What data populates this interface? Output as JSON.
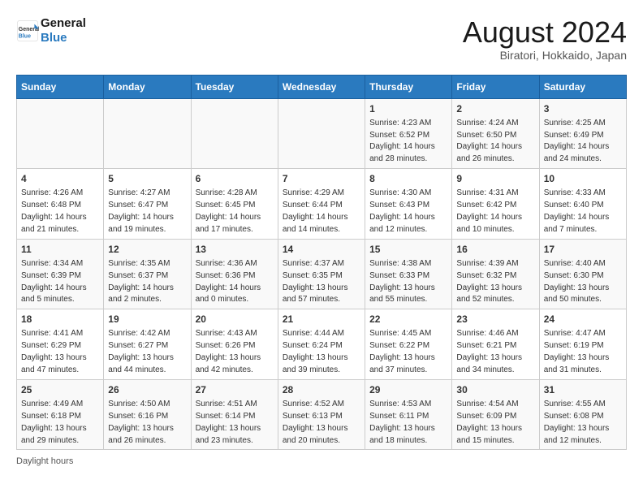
{
  "logo": {
    "line1": "General",
    "line2": "Blue"
  },
  "title": "August 2024",
  "location": "Biratori, Hokkaido, Japan",
  "weekdays": [
    "Sunday",
    "Monday",
    "Tuesday",
    "Wednesday",
    "Thursday",
    "Friday",
    "Saturday"
  ],
  "footer": "Daylight hours",
  "weeks": [
    [
      {
        "day": "",
        "info": ""
      },
      {
        "day": "",
        "info": ""
      },
      {
        "day": "",
        "info": ""
      },
      {
        "day": "",
        "info": ""
      },
      {
        "day": "1",
        "info": "Sunrise: 4:23 AM\nSunset: 6:52 PM\nDaylight: 14 hours and 28 minutes."
      },
      {
        "day": "2",
        "info": "Sunrise: 4:24 AM\nSunset: 6:50 PM\nDaylight: 14 hours and 26 minutes."
      },
      {
        "day": "3",
        "info": "Sunrise: 4:25 AM\nSunset: 6:49 PM\nDaylight: 14 hours and 24 minutes."
      }
    ],
    [
      {
        "day": "4",
        "info": "Sunrise: 4:26 AM\nSunset: 6:48 PM\nDaylight: 14 hours and 21 minutes."
      },
      {
        "day": "5",
        "info": "Sunrise: 4:27 AM\nSunset: 6:47 PM\nDaylight: 14 hours and 19 minutes."
      },
      {
        "day": "6",
        "info": "Sunrise: 4:28 AM\nSunset: 6:45 PM\nDaylight: 14 hours and 17 minutes."
      },
      {
        "day": "7",
        "info": "Sunrise: 4:29 AM\nSunset: 6:44 PM\nDaylight: 14 hours and 14 minutes."
      },
      {
        "day": "8",
        "info": "Sunrise: 4:30 AM\nSunset: 6:43 PM\nDaylight: 14 hours and 12 minutes."
      },
      {
        "day": "9",
        "info": "Sunrise: 4:31 AM\nSunset: 6:42 PM\nDaylight: 14 hours and 10 minutes."
      },
      {
        "day": "10",
        "info": "Sunrise: 4:33 AM\nSunset: 6:40 PM\nDaylight: 14 hours and 7 minutes."
      }
    ],
    [
      {
        "day": "11",
        "info": "Sunrise: 4:34 AM\nSunset: 6:39 PM\nDaylight: 14 hours and 5 minutes."
      },
      {
        "day": "12",
        "info": "Sunrise: 4:35 AM\nSunset: 6:37 PM\nDaylight: 14 hours and 2 minutes."
      },
      {
        "day": "13",
        "info": "Sunrise: 4:36 AM\nSunset: 6:36 PM\nDaylight: 14 hours and 0 minutes."
      },
      {
        "day": "14",
        "info": "Sunrise: 4:37 AM\nSunset: 6:35 PM\nDaylight: 13 hours and 57 minutes."
      },
      {
        "day": "15",
        "info": "Sunrise: 4:38 AM\nSunset: 6:33 PM\nDaylight: 13 hours and 55 minutes."
      },
      {
        "day": "16",
        "info": "Sunrise: 4:39 AM\nSunset: 6:32 PM\nDaylight: 13 hours and 52 minutes."
      },
      {
        "day": "17",
        "info": "Sunrise: 4:40 AM\nSunset: 6:30 PM\nDaylight: 13 hours and 50 minutes."
      }
    ],
    [
      {
        "day": "18",
        "info": "Sunrise: 4:41 AM\nSunset: 6:29 PM\nDaylight: 13 hours and 47 minutes."
      },
      {
        "day": "19",
        "info": "Sunrise: 4:42 AM\nSunset: 6:27 PM\nDaylight: 13 hours and 44 minutes."
      },
      {
        "day": "20",
        "info": "Sunrise: 4:43 AM\nSunset: 6:26 PM\nDaylight: 13 hours and 42 minutes."
      },
      {
        "day": "21",
        "info": "Sunrise: 4:44 AM\nSunset: 6:24 PM\nDaylight: 13 hours and 39 minutes."
      },
      {
        "day": "22",
        "info": "Sunrise: 4:45 AM\nSunset: 6:22 PM\nDaylight: 13 hours and 37 minutes."
      },
      {
        "day": "23",
        "info": "Sunrise: 4:46 AM\nSunset: 6:21 PM\nDaylight: 13 hours and 34 minutes."
      },
      {
        "day": "24",
        "info": "Sunrise: 4:47 AM\nSunset: 6:19 PM\nDaylight: 13 hours and 31 minutes."
      }
    ],
    [
      {
        "day": "25",
        "info": "Sunrise: 4:49 AM\nSunset: 6:18 PM\nDaylight: 13 hours and 29 minutes."
      },
      {
        "day": "26",
        "info": "Sunrise: 4:50 AM\nSunset: 6:16 PM\nDaylight: 13 hours and 26 minutes."
      },
      {
        "day": "27",
        "info": "Sunrise: 4:51 AM\nSunset: 6:14 PM\nDaylight: 13 hours and 23 minutes."
      },
      {
        "day": "28",
        "info": "Sunrise: 4:52 AM\nSunset: 6:13 PM\nDaylight: 13 hours and 20 minutes."
      },
      {
        "day": "29",
        "info": "Sunrise: 4:53 AM\nSunset: 6:11 PM\nDaylight: 13 hours and 18 minutes."
      },
      {
        "day": "30",
        "info": "Sunrise: 4:54 AM\nSunset: 6:09 PM\nDaylight: 13 hours and 15 minutes."
      },
      {
        "day": "31",
        "info": "Sunrise: 4:55 AM\nSunset: 6:08 PM\nDaylight: 13 hours and 12 minutes."
      }
    ]
  ]
}
